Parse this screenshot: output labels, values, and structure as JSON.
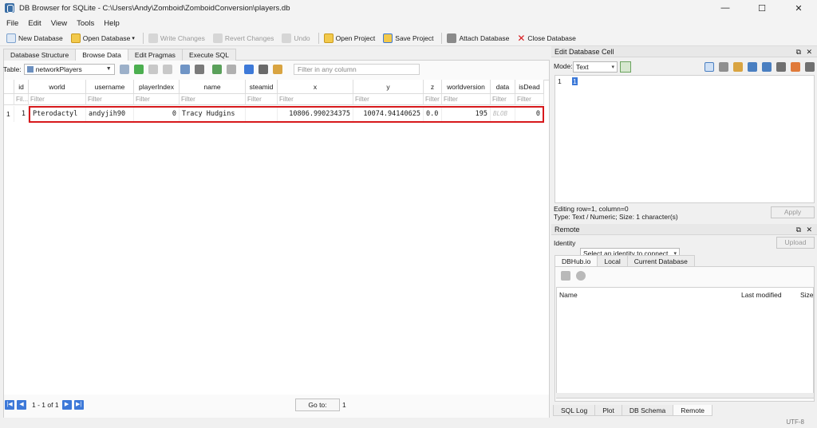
{
  "window": {
    "title": "DB Browser for SQLite - C:\\Users\\Andy\\Zomboid\\ZomboidConversion\\players.db",
    "minimize": "—",
    "maximize": "☐",
    "close": "✕"
  },
  "menu": [
    "File",
    "Edit",
    "View",
    "Tools",
    "Help"
  ],
  "toolbar": {
    "new_database": "New Database",
    "open_database": "Open Database",
    "write_changes": "Write Changes",
    "revert_changes": "Revert Changes",
    "undo": "Undo",
    "open_project": "Open Project",
    "save_project": "Save Project",
    "attach_database": "Attach Database",
    "close_database": "Close Database"
  },
  "tabs": [
    "Database Structure",
    "Browse Data",
    "Edit Pragmas",
    "Execute SQL"
  ],
  "browse": {
    "table_label": "Table:",
    "table_value": "networkPlayers",
    "filter_placeholder": "Filter in any column",
    "columns": [
      "id",
      "world",
      "username",
      "playerIndex",
      "name",
      "steamid",
      "x",
      "y",
      "z",
      "worldversion",
      "data",
      "isDead"
    ],
    "filter_labels": [
      "Fil...",
      "Filter",
      "Filter",
      "Filter",
      "Filter",
      "Filter",
      "Filter",
      "Filter",
      "Filter",
      "Filter",
      "Filter",
      "Filter"
    ],
    "rows": [
      {
        "rownum": "1",
        "cells": [
          "1",
          "Pterodactyl",
          "andyjih90",
          "0",
          "Tracy Hudgins",
          "",
          "10806.990234375",
          "10074.94140625",
          "0.0",
          "195",
          "BLOB",
          "0"
        ]
      }
    ]
  },
  "navigation": {
    "first": "|◀",
    "prev": "◀",
    "range": "1 - 1 of 1",
    "next": "▶",
    "last": "▶|",
    "goto_label": "Go to:",
    "goto_value": "1"
  },
  "edit_cell": {
    "title": "Edit Database Cell",
    "mode_label": "Mode:",
    "mode_value": "Text",
    "line_number": "1",
    "content": "1",
    "info_line1": "Editing row=1, column=0",
    "info_line2": "Type: Text / Numeric; Size: 1 character(s)",
    "apply": "Apply"
  },
  "remote": {
    "title": "Remote",
    "identity_label": "Identity",
    "identity_value": "Select an identity to connect",
    "upload": "Upload",
    "tabs": [
      "DBHub.io",
      "Local",
      "Current Database"
    ],
    "columns": [
      "Name",
      "Last modified",
      "Size"
    ]
  },
  "bottom_tabs": [
    "SQL Log",
    "Plot",
    "DB Schema",
    "Remote"
  ],
  "status": {
    "encoding": "UTF-8"
  },
  "colors": {
    "highlight": "#d7191c",
    "nav_blue": "#3d79d8",
    "selection": "#3b78d8"
  }
}
